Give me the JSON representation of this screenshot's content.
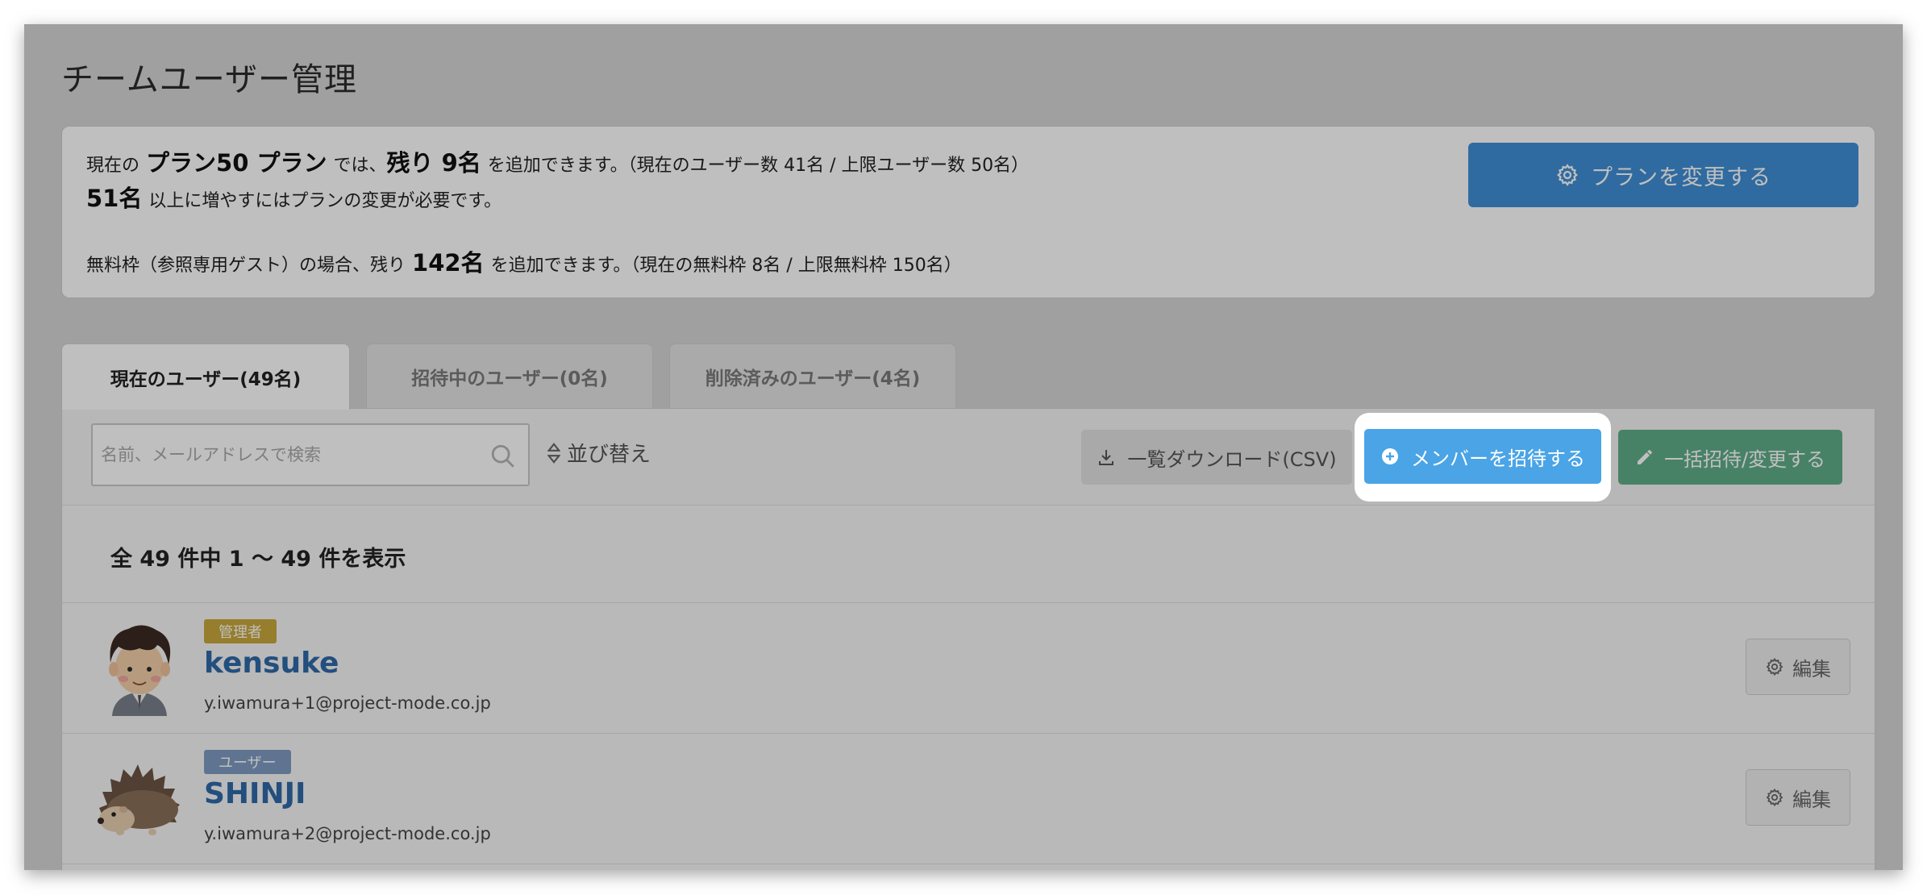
{
  "page": {
    "title": "チームユーザー管理"
  },
  "plan": {
    "line1": [
      "現在の",
      "プラン50 プラン",
      "では、",
      "残り 9名",
      "を追加できます。（現在のユーザー数 41名 / 上限ユーザー数 50名）"
    ],
    "line2": [
      "51名",
      "以上に増やすにはプランの変更が必要です。"
    ],
    "line3": [
      "無料枠（参照専用ゲスト）の場合、残り",
      "142名",
      "を追加できます。（現在の無料枠 8名 / 上限無料枠 150名）"
    ],
    "change_button": "プランを変更する",
    "change_icon": "gear-icon"
  },
  "tabs": [
    {
      "label": "現在のユーザー(49名)",
      "active": true
    },
    {
      "label": "招待中のユーザー(0名)",
      "active": false
    },
    {
      "label": "削除済みのユーザー(4名)",
      "active": false
    }
  ],
  "toolbar": {
    "search_placeholder": "名前、メールアドレスで検索",
    "search_icon": "search-icon",
    "sort_label": "並び替え",
    "download_label": "一覧ダウンロード(CSV)",
    "invite_label": "メンバーを招待する",
    "bulk_label": "一括招待/変更する"
  },
  "count_text": "全 49 件中 1 〜 49 件を表示",
  "users": [
    {
      "role": "管理者",
      "role_type": "admin",
      "name": "kensuke",
      "email": "y.iwamura+1@project-mode.co.jp",
      "edit_label": "編集",
      "avatar": "person-avatar"
    },
    {
      "role": "ユーザー",
      "role_type": "user",
      "name": "SHINJI",
      "email": "y.iwamura+2@project-mode.co.jp",
      "edit_label": "編集",
      "avatar": "hedgehog-avatar"
    }
  ],
  "colors": {
    "primary": "#3f8fd6",
    "invite": "#4aa4e6",
    "bulk": "#5fae8a",
    "admin_badge": "#c9a93b",
    "user_badge": "#7f9bc2",
    "username": "#2f6aa8"
  }
}
